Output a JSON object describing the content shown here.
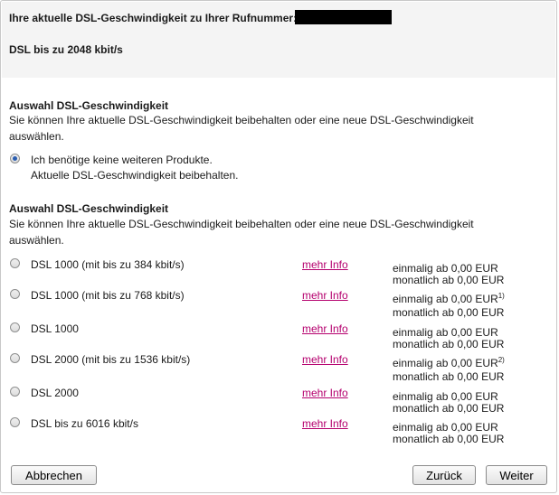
{
  "header": {
    "current_speed_label": "Ihre aktuelle DSL-Geschwindigkeit zu Ihrer Rufnummer:",
    "current_speed_value": "DSL bis zu 2048 kbit/s"
  },
  "section1": {
    "title": "Auswahl DSL-Geschwindigkeit",
    "desc_line1": "Sie können Ihre aktuelle DSL-Geschwindigkeit beibehalten oder eine neue DSL-Geschwindigkeit",
    "desc_line2": "auswählen.",
    "keep_option_line1": "Ich benötige keine weiteren Produkte.",
    "keep_option_line2": "Aktuelle DSL-Geschwindigkeit beibehalten."
  },
  "section2": {
    "title": "Auswahl DSL-Geschwindigkeit",
    "desc_line1": "Sie können Ihre aktuelle DSL-Geschwindigkeit beibehalten oder eine neue DSL-Geschwindigkeit",
    "desc_line2": "auswählen.",
    "options": [
      {
        "name": "DSL 1000 (mit bis zu 384 kbit/s)",
        "link": "mehr Info",
        "once": "einmalig ab 0,00 EUR",
        "once_note": "",
        "monthly": "monatlich ab 0,00 EUR"
      },
      {
        "name": "DSL 1000 (mit bis zu 768 kbit/s)",
        "link": "mehr Info",
        "once": "einmalig ab 0,00 EUR",
        "once_note": "1)",
        "monthly": "monatlich ab 0,00 EUR"
      },
      {
        "name": "DSL 1000",
        "link": "mehr Info",
        "once": "einmalig ab 0,00 EUR",
        "once_note": "",
        "monthly": "monatlich ab 0,00 EUR"
      },
      {
        "name": "DSL 2000 (mit bis zu 1536 kbit/s)",
        "link": "mehr Info",
        "once": "einmalig ab 0,00 EUR",
        "once_note": "2)",
        "monthly": "monatlich ab 0,00 EUR"
      },
      {
        "name": "DSL 2000",
        "link": "mehr Info",
        "once": "einmalig ab 0,00 EUR",
        "once_note": "",
        "monthly": "monatlich ab 0,00 EUR"
      },
      {
        "name": "DSL bis zu 6016 kbit/s",
        "link": "mehr Info",
        "once": "einmalig ab 0,00 EUR",
        "once_note": "",
        "monthly": "monatlich ab 0,00 EUR"
      }
    ]
  },
  "buttons": {
    "cancel": "Abbrechen",
    "back": "Zurück",
    "next": "Weiter"
  },
  "colors": {
    "link": "#b5006e",
    "top_band": "#f4f4f4"
  }
}
